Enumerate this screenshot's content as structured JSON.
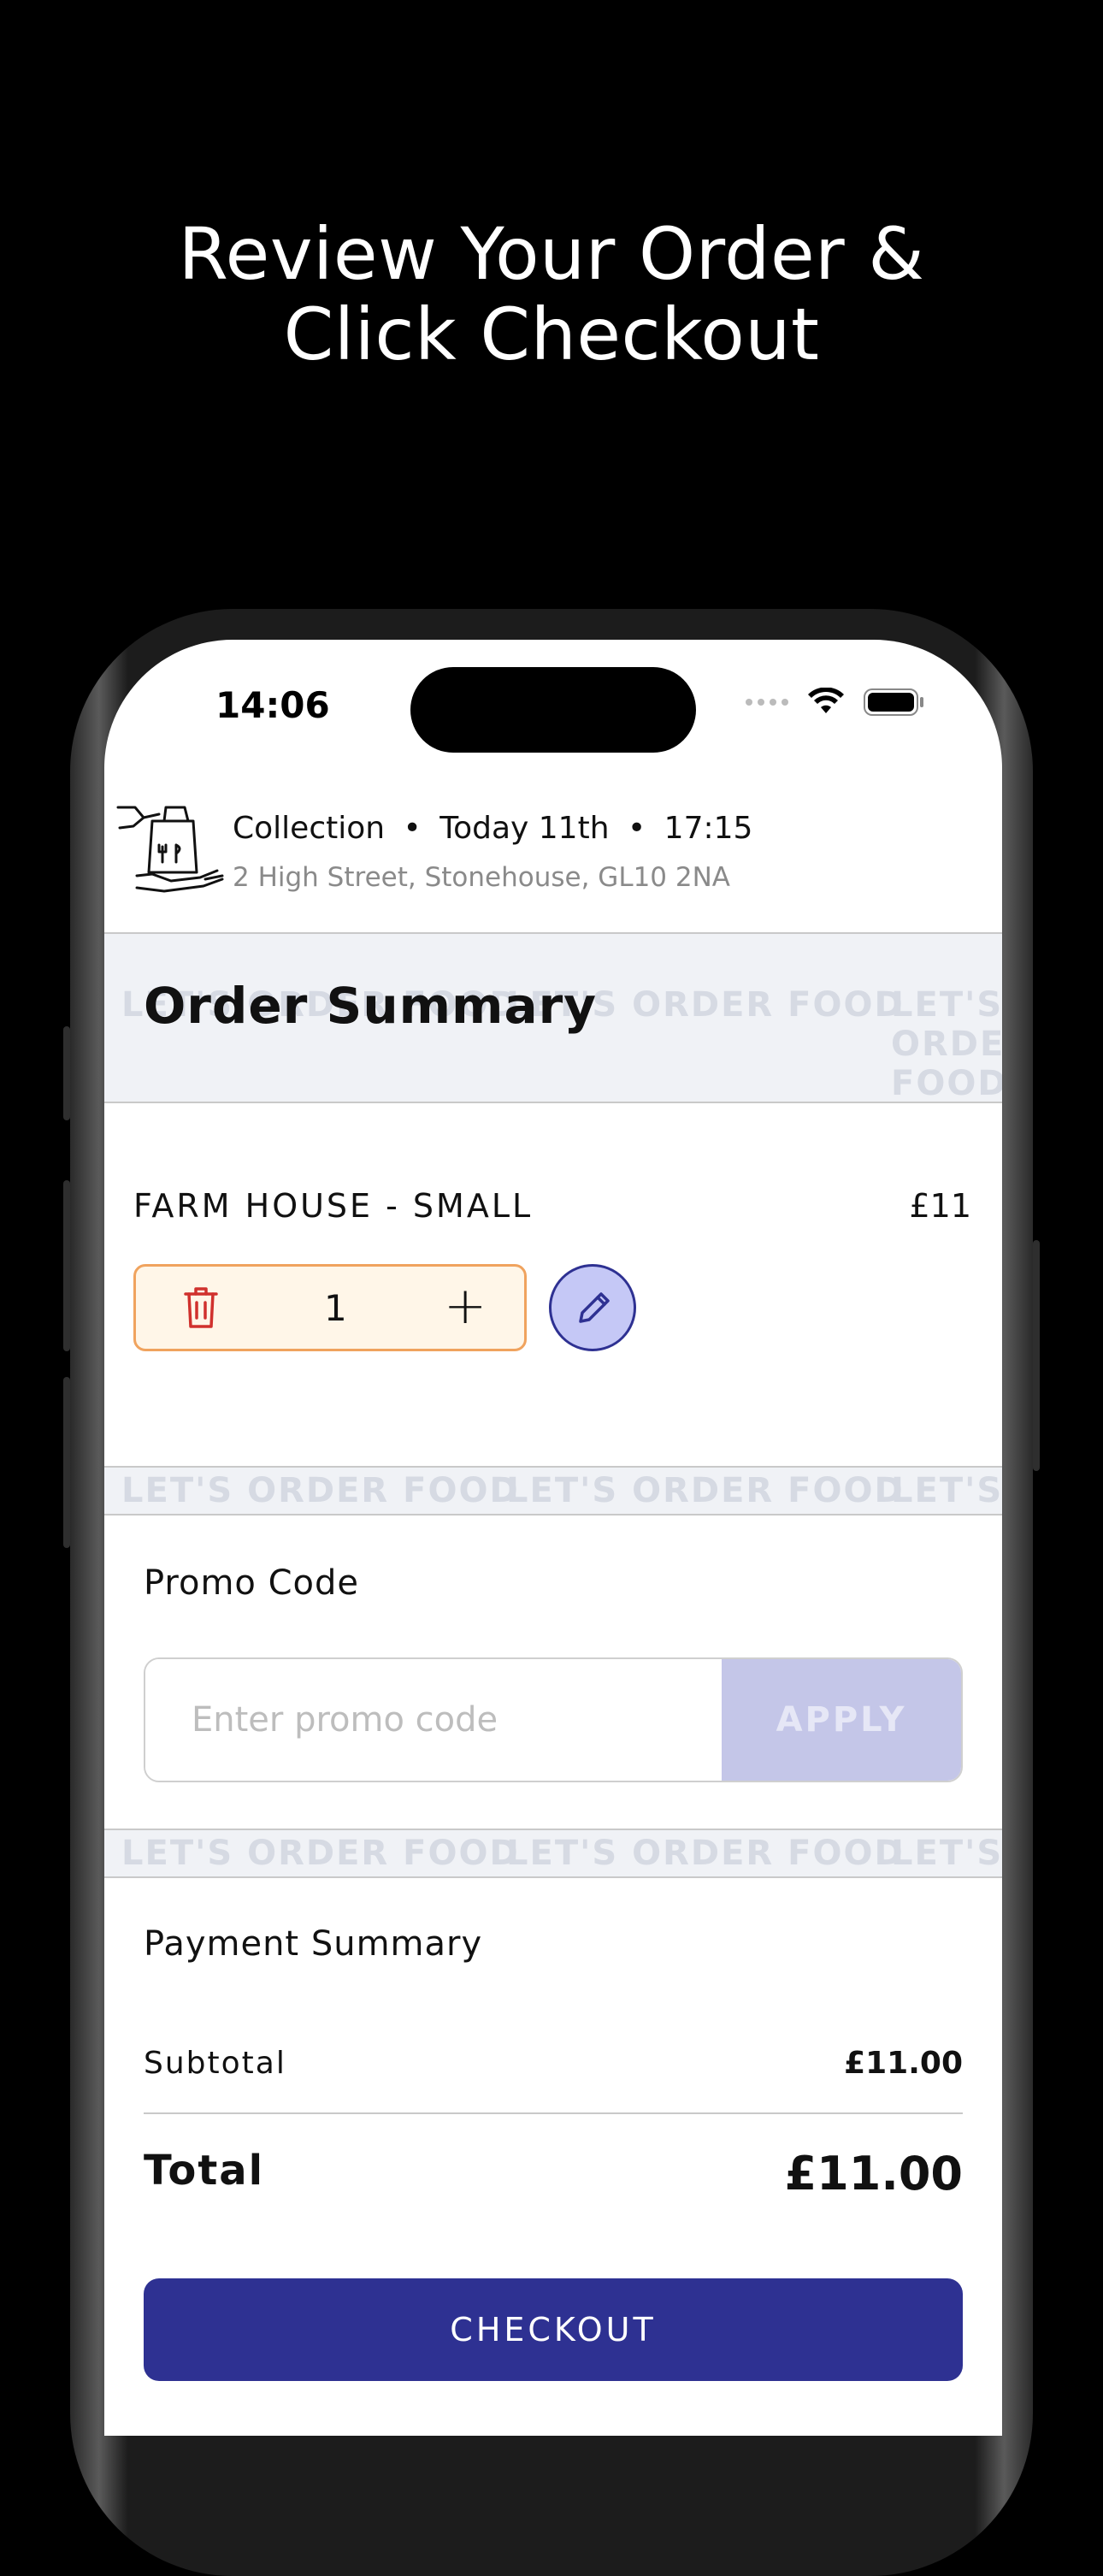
{
  "headline": {
    "line1": "Review Your Order &",
    "line2": "Click Checkout"
  },
  "status_bar": {
    "time": "14:06",
    "icons": [
      "signal-dots-icon",
      "wifi-icon",
      "battery-icon"
    ]
  },
  "order_info": {
    "mode": "Collection",
    "day": "Today 11th",
    "time": "17:15",
    "separator": "•",
    "address": "2 High Street, Stonehouse, GL10  2NA",
    "icon": "collection-bag-icon"
  },
  "pattern_text": "LET'S ORDER FOOD",
  "order_summary": {
    "title": "Order Summary"
  },
  "cart": {
    "items": [
      {
        "name": "FARM HOUSE - SMALL",
        "price": "£11",
        "quantity": "1"
      }
    ]
  },
  "promo": {
    "title": "Promo Code",
    "placeholder": "Enter promo code",
    "apply_label": "APPLY"
  },
  "payment": {
    "title": "Payment Summary",
    "subtotal_label": "Subtotal",
    "subtotal_value": "£11.00",
    "total_label": "Total",
    "total_value": "£11.00"
  },
  "checkout_label": "CHECKOUT",
  "colors": {
    "primary": "#2e3192",
    "qty_border": "#f0a35e",
    "qty_bg": "#fff6e8",
    "trash_red": "#d0312d",
    "apply_disabled": "#c4c6e8"
  }
}
